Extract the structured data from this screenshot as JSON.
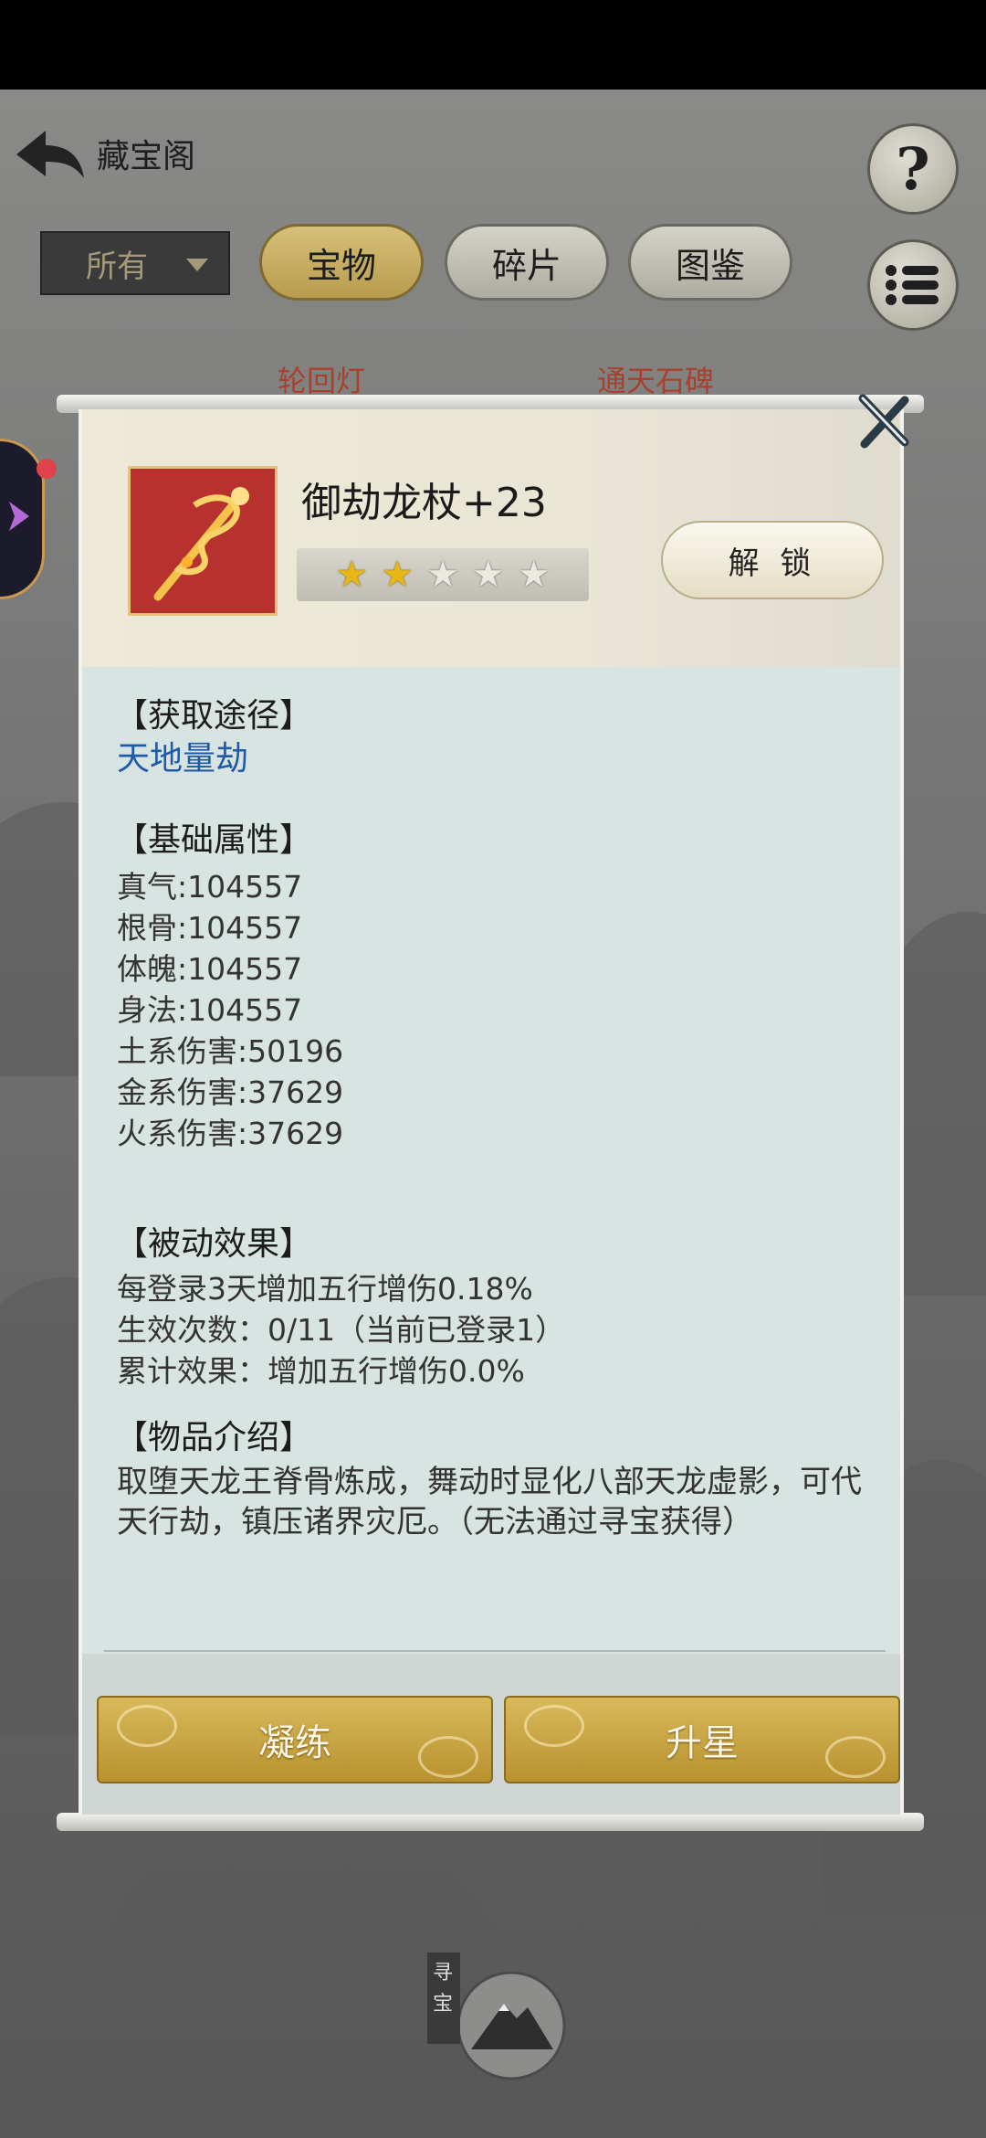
{
  "header": {
    "title": "藏宝阁",
    "help_glyph": "?"
  },
  "filter": {
    "selected": "所有"
  },
  "tabs": [
    {
      "label": "宝物",
      "active": true
    },
    {
      "label": "碎片",
      "active": false
    },
    {
      "label": "图鉴",
      "active": false
    }
  ],
  "background_items": [
    "轮回灯",
    "通天石碑"
  ],
  "item": {
    "name": "御劫龙杖+23",
    "stars_filled": 2,
    "stars_total": 5,
    "unlock_label": "解 锁"
  },
  "sections": {
    "source_title": "【获取途径】",
    "source_link": "天地量劫",
    "attr_title": "【基础属性】",
    "attributes": [
      "真气:104557",
      "根骨:104557",
      "体魄:104557",
      "身法:104557",
      "土系伤害:50196",
      "金系伤害:37629",
      "火系伤害:37629"
    ],
    "passive_title": "【被动效果】",
    "passive_lines": [
      "每登录3天增加五行增伤0.18%",
      "生效次数：0/11（当前已登录1）",
      "累计效果：增加五行增伤0.0%"
    ],
    "intro_title": "【物品介绍】",
    "intro_text": "取堕天龙王脊骨炼成，舞动时显化八部天龙虚影，可代天行劫，镇压诸界灾厄。（无法通过寻宝获得）"
  },
  "actions": {
    "refine_label": "凝练",
    "star_up_label": "升星"
  },
  "bottom": {
    "treasure_label": "寻宝"
  },
  "colors": {
    "accent_gold": "#c9a646",
    "link_blue": "#1e5aa8",
    "icon_red": "#b7322e"
  }
}
